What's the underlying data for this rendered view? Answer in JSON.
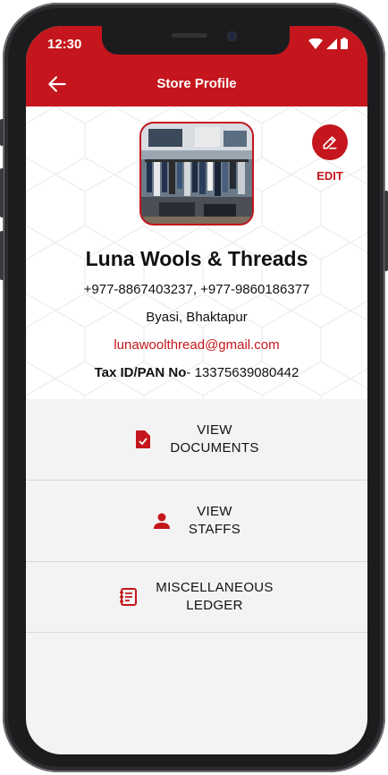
{
  "status_bar": {
    "time": "12:30"
  },
  "app_bar": {
    "title": "Store Profile"
  },
  "profile": {
    "edit_label": "EDIT",
    "store_name": "Luna Wools & Threads",
    "phones": "+977-8867403237, +977-9860186377",
    "address": "Byasi, Bhaktapur",
    "email": "lunawoolthread@gmail.com",
    "tax_label": "Tax ID/PAN No",
    "tax_value": "- 13375639080442"
  },
  "menu": {
    "items": [
      {
        "label": "VIEW\nDOCUMENTS",
        "icon": "document-check-icon"
      },
      {
        "label": "VIEW\nSTAFFS",
        "icon": "person-icon"
      },
      {
        "label": "MISCELLANEOUS\nLEDGER",
        "icon": "ledger-book-icon"
      }
    ]
  },
  "colors": {
    "accent": "#c4161c",
    "background": "#f3f3f3",
    "divider": "#d7d7d7"
  }
}
